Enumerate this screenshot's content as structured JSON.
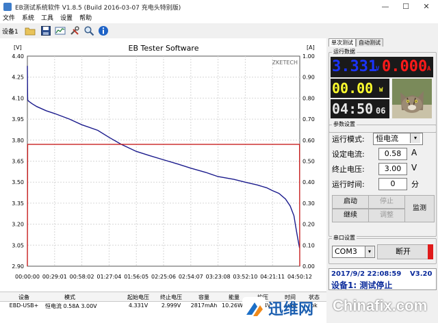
{
  "window": {
    "title": "EB测试系统软件 V1.8.5 (Build 2016-03-07 充电头特别版)",
    "min_glyph": "—",
    "max_glyph": "☐",
    "close_glyph": "✕"
  },
  "menu": [
    "文件",
    "系统",
    "工具",
    "设置",
    "帮助"
  ],
  "toolbar": {
    "device_label": "设备1"
  },
  "tabs": [
    "单次测试",
    "自动测试"
  ],
  "readout": {
    "group_title": "运行数据",
    "voltage": "3.331",
    "voltage_unit": "V",
    "current": "0.000",
    "current_unit": "A",
    "power": "00.00",
    "power_unit": "W",
    "time": "04:50",
    "time_sec": "06",
    "colors": {
      "voltage": "#1a34ff",
      "current": "#ff1a1a",
      "power": "#ffff2e",
      "time": "#e8e8e8"
    }
  },
  "params": {
    "group_title": "参数设置",
    "mode_label": "运行模式:",
    "mode_value": "恒电流",
    "current_label": "设定电流:",
    "current_value": "0.58",
    "current_unit": "A",
    "cutoff_label": "终止电压:",
    "cutoff_value": "3.00",
    "cutoff_unit": "V",
    "time_label": "运行时间:",
    "time_value": "0",
    "time_unit": "分"
  },
  "controls": {
    "start": "启动",
    "stop": "停止",
    "continue": "继续",
    "adjust": "调整",
    "monitor": "监测"
  },
  "serial": {
    "group_title": "串口设置",
    "port": "COM3",
    "disconnect": "断开"
  },
  "status": {
    "datetime": "2017/9/2 22:08:59",
    "version": "V3.20",
    "message": "设备1: 测试停止"
  },
  "table": {
    "headers": [
      "设备",
      "模式",
      "起始电压",
      "终止电压",
      "容量",
      "能量",
      "均压",
      "时间",
      "状态"
    ],
    "row": [
      "EBD-USB+",
      "恒电流 0.58A 3.00V",
      "4.331V",
      "2.999V",
      "2817mAh",
      "10.26Wh",
      "3.64V",
      "4:50",
      "ok"
    ]
  },
  "watermark": {
    "brand": "迅维网",
    "site": "Chinafix.com"
  },
  "chart_data": {
    "type": "line",
    "title": "EB Tester Software",
    "corner_label": "ZKETECH",
    "ylabel_left": "[V]",
    "ylabel_right": "[A]",
    "ylim_left": [
      2.9,
      4.4
    ],
    "ylim_right": [
      0,
      1.0
    ],
    "y_ticks_left": [
      "4.40",
      "4.25",
      "4.10",
      "3.95",
      "3.80",
      "3.65",
      "3.50",
      "3.35",
      "3.20",
      "3.05",
      "2.90"
    ],
    "y_ticks_right": [
      "1.00",
      "0.90",
      "0.80",
      "0.70",
      "0.60",
      "0.50",
      "0.40",
      "0.30",
      "0.20",
      "0.10",
      "0.00"
    ],
    "x_ticks": [
      "00:00:00",
      "00:29:01",
      "00:58:02",
      "01:27:04",
      "01:56:05",
      "02:25:06",
      "02:54:07",
      "03:23:08",
      "03:52:10",
      "04:21:11",
      "04:50:12"
    ],
    "grid": true,
    "series": [
      {
        "axis": "left",
        "color": "#1a1a8c",
        "x_min": [
          0,
          0.3,
          1,
          5,
          10,
          20,
          29,
          45,
          58,
          75,
          87,
          100,
          116,
          130,
          145,
          160,
          174,
          190,
          203,
          220,
          232,
          245,
          255,
          261,
          268,
          275,
          280,
          284,
          286,
          288,
          290
        ],
        "y": [
          4.33,
          4.09,
          4.08,
          4.06,
          4.04,
          4.01,
          3.99,
          3.95,
          3.91,
          3.87,
          3.82,
          3.77,
          3.72,
          3.69,
          3.66,
          3.63,
          3.6,
          3.57,
          3.54,
          3.52,
          3.5,
          3.48,
          3.46,
          3.44,
          3.42,
          3.38,
          3.33,
          3.26,
          3.18,
          3.1,
          3.03
        ]
      },
      {
        "axis": "right",
        "color": "#c81e1e",
        "x_min": [
          0,
          0.3,
          290,
          290.2
        ],
        "y": [
          0.0,
          0.58,
          0.58,
          0.0
        ]
      }
    ]
  }
}
